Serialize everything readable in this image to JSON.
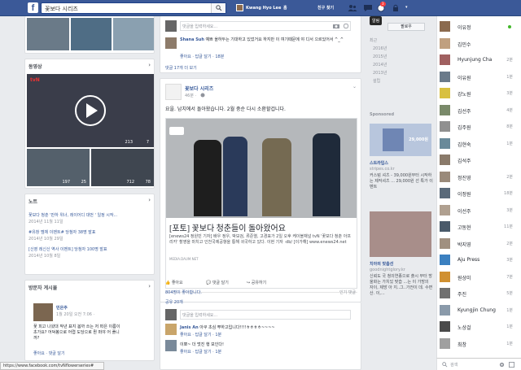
{
  "topbar": {
    "logo": "f",
    "search_value": "꽃보다 시리즈",
    "user_name": "Kwang Hyo Lee",
    "home": "홈",
    "friends": "친구 찾기",
    "tooltip": "알림",
    "notif_count": "3",
    "more": "▾"
  },
  "left": {
    "video_header": "동영상",
    "video1_overlay": "tvN",
    "video1_likes": "213",
    "video1_comments": "7",
    "video2_likes": "197",
    "video2_comments": "25",
    "video3_likes": "712",
    "video3_comments": "78",
    "notes_header": "노트",
    "notes": [
      {
        "title": "꽃보다 청춘 '만하 위너, 레이어디 대번 ' 일정 시작...",
        "date": "2014년 11월 11일"
      },
      {
        "title": "#유창 멤체 이벤트# 당첨자 38명 발표",
        "date": "2014년 10월 29일"
      },
      {
        "title": "[신영 레신신 역사 이벤트] 당첨자 100명 발표",
        "date": "2014년 10월 8일"
      }
    ],
    "visitor_header": "방문자 게시물",
    "visitor_name": "민은주",
    "visitor_date": "1월 20일 오전 7:06 ·",
    "visitor_text1": "꽃 피고 나왔대 작년 표지 봄까 쓰는 저 떠은 이름이",
    "visitor_text2": "초가요? 어덕봉으로 어렵 도당으로 뭔 퍼야 어 플니",
    "visitor_text3": "까?",
    "visitor_actions": "좋아요 · 댓글 달기",
    "status_url": "https://www.facebook.com/tvNflowerseries#"
  },
  "feed": {
    "comment_placeholder": "댓글을 입력하세요...",
    "c1_name": "Shana Suh",
    "c1_text": "예쁘 올하두는 기대하고 있었거요 하지만 이 여기때문에 야 디서 으르있어서 ^_^",
    "c1_actions": "좋아요 · 답글 달기 · 18분",
    "more_comments": "댓글 17개 더 보기",
    "post_author": "꽃보다 시리즈",
    "post_time": "46분 · ",
    "post_text": "요을. 남치에서 돌아왔습니다. 2월 중순 다시 소환할겁니다.",
    "link_title": "[포토] 꽃보다 청춘들이 돌아왔어요",
    "link_desc": "[enews24 정원빈 기자] 배우 정우, 박보검, 류준열, 고경표가 2일 오후 케이블채널 tvN '꽃보다 청춘 아프리카' 촬영을 마치고 인천국제공항을 통해 귀국하고 있다. 이현 기자 ·db/ [이가해] www.enews24.net",
    "link_source": "MEDIA.DAUM.NET",
    "like": "좋아요",
    "comment": "댓글 달기",
    "share": "공유하기",
    "likes_count": "804명이 좋아합니다.",
    "sort": "인기 댓글",
    "shares_count": "공유 20개",
    "c2_name": "Janis An",
    "c2_text": "아쿠 초심 뿌하고입니다!!!!ㅎㅎㅎㅎ~~~~",
    "c2_actions": "좋아요 · 답글 달기 · 1분",
    "c3_text": "이뽀~ 더 멋진 행 보인다!",
    "c3_actions": "좋아요 · 답글 달기 · 1분"
  },
  "timeline": {
    "recent": "최근",
    "years": [
      "2016년",
      "2015년",
      "2014년",
      "2013년",
      "설립"
    ],
    "follow": "팔로우",
    "sponsored": "Sponsored",
    "ad1_price": "29,000원",
    "ad1_title": "스트라입스",
    "ad1_url": "stripes.co.kr",
    "ad1_text": "커스텀 셔츠 - 39,000원부터 시작하는 제작셔츠 ... 29,000원 선 특가 이벤트",
    "ad2_title": "치아의 맞춤선",
    "ad2_url": "goodnightglory.kr",
    "ad2_text": "신뢰도 국 청의연종으로 출시 부터 방울화는 가치있 맞습 ...는 이 가방의 자이, 제방 아 지..그..가전이 데. 수면산. 이,..."
  },
  "chat": {
    "contacts": [
      {
        "name": "이유정",
        "status": "online"
      },
      {
        "name": "김민수",
        "status": ""
      },
      {
        "name": "Hyunjung Cha",
        "status": "2분"
      },
      {
        "name": "이유원",
        "status": "1분"
      },
      {
        "name": "강노원",
        "status": "3분"
      },
      {
        "name": "김선주",
        "status": "4분"
      },
      {
        "name": "김주원",
        "status": "8분"
      },
      {
        "name": "김현숙",
        "status": "1분"
      },
      {
        "name": "김석주",
        "status": ""
      },
      {
        "name": "정진영",
        "status": "2분"
      },
      {
        "name": "이정원",
        "status": "18분"
      },
      {
        "name": "이선주",
        "status": "3분"
      },
      {
        "name": "고동현",
        "status": "11분"
      },
      {
        "name": "박지영",
        "status": "2분"
      },
      {
        "name": "Aju Press",
        "status": "3분"
      },
      {
        "name": "원상미",
        "status": "7분"
      },
      {
        "name": "주진",
        "status": "5분"
      },
      {
        "name": "Kyungjin Chung",
        "status": "1분"
      },
      {
        "name": "노상걸",
        "status": "1분"
      },
      {
        "name": "최창",
        "status": "1분"
      }
    ],
    "search_placeholder": "검색"
  },
  "colors": {
    "brand": "#3b5998",
    "link": "#365899",
    "online": "#42b72a"
  }
}
